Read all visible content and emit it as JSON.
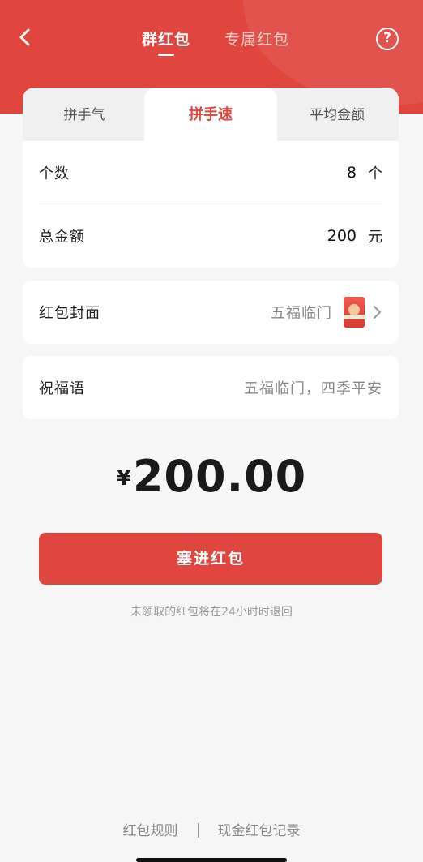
{
  "header": {
    "tabs": [
      {
        "label": "群红包",
        "active": true
      },
      {
        "label": "专属红包",
        "active": false
      }
    ],
    "help_label": "?",
    "color": "#e0453e"
  },
  "mode_tabs": [
    {
      "label": "拼手气",
      "active": false
    },
    {
      "label": "拼手速",
      "active": true
    },
    {
      "label": "平均金额",
      "active": false
    }
  ],
  "form": {
    "count": {
      "label": "个数",
      "value": "8",
      "unit": "个"
    },
    "total": {
      "label": "总金额",
      "value": "200",
      "unit": "元"
    },
    "cover": {
      "label": "红包封面",
      "value": "五福临门"
    },
    "blessing": {
      "label": "祝福语",
      "placeholder": "五福临门，四季平安"
    }
  },
  "amount": {
    "currency": "¥",
    "value": "200.00"
  },
  "submit_label": "塞进红包",
  "hint": "未领取的红包将在24小时时退回",
  "footer": {
    "rules": "红包规则",
    "records": "现金红包记录"
  }
}
